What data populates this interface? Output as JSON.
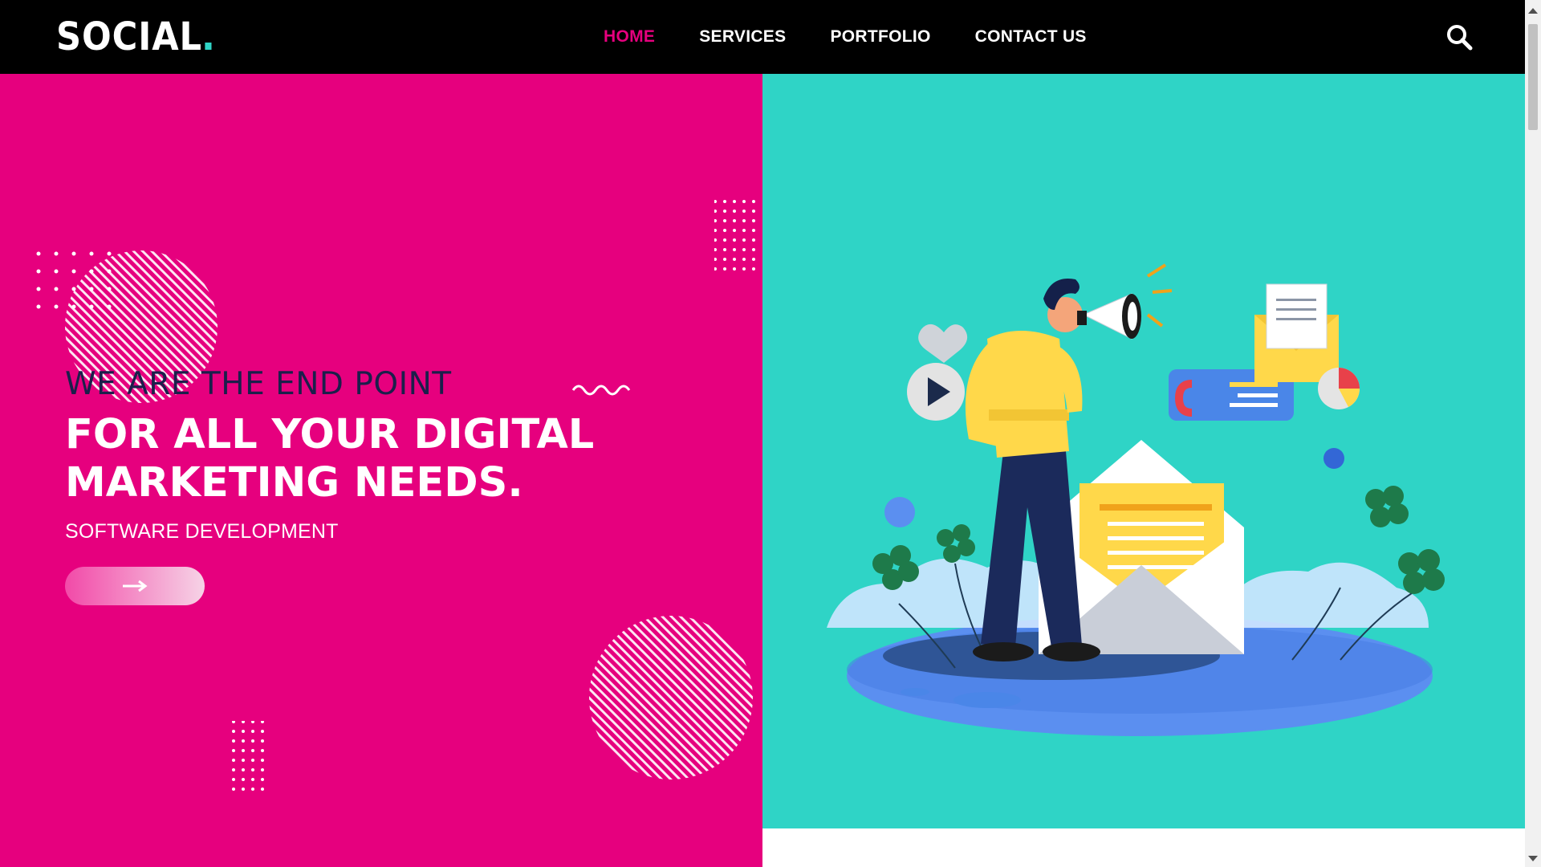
{
  "brand": {
    "logo_text": "SOCIAL"
  },
  "nav": {
    "items": [
      {
        "label": "HOME",
        "active": true
      },
      {
        "label": "SERVICES",
        "active": false
      },
      {
        "label": "PORTFOLIO",
        "active": false
      },
      {
        "label": "CONTACT US",
        "active": false
      }
    ],
    "search_icon": "search-icon"
  },
  "hero": {
    "headline_1": "WE ARE THE END POINT",
    "headline_2": "FOR ALL YOUR DIGITAL MARKETING NEEDS.",
    "tagline": "SOFTWARE DEVELOPMENT",
    "cta_icon": "arrow-right-icon"
  },
  "colors": {
    "primary_magenta": "#e6007e",
    "teal": "#2fd4c6",
    "navy": "#1b1f4b",
    "black": "#000000",
    "white": "#ffffff"
  }
}
